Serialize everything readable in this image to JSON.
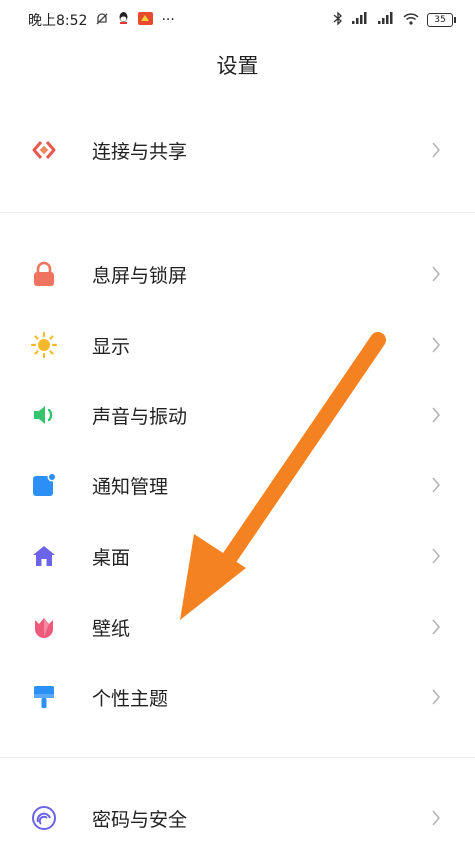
{
  "status_bar": {
    "time": "晚上8:52",
    "more": "···",
    "battery": "35"
  },
  "header": {
    "title": "设置"
  },
  "groups": [
    {
      "items": [
        {
          "label": "连接与共享",
          "icon": "share-icon",
          "color": "#e8584a"
        }
      ]
    },
    {
      "items": [
        {
          "label": "息屏与锁屏",
          "icon": "lock-icon",
          "color": "#ef7460"
        },
        {
          "label": "显示",
          "icon": "sun-icon",
          "color": "#f5b829"
        },
        {
          "label": "声音与振动",
          "icon": "speaker-icon",
          "color": "#33c46c"
        },
        {
          "label": "通知管理",
          "icon": "notification-icon",
          "color": "#2b8ff5"
        },
        {
          "label": "桌面",
          "icon": "home-icon",
          "color": "#6c64e8"
        },
        {
          "label": "壁纸",
          "icon": "tulip-icon",
          "color": "#ef5a7a"
        },
        {
          "label": "个性主题",
          "icon": "brush-icon",
          "color": "#2b8ff5"
        }
      ]
    },
    {
      "items": [
        {
          "label": "密码与安全",
          "icon": "fingerprint-icon",
          "color": "#6c64e8"
        }
      ]
    }
  ],
  "annotation": {
    "arrow_color": "#f58220"
  }
}
